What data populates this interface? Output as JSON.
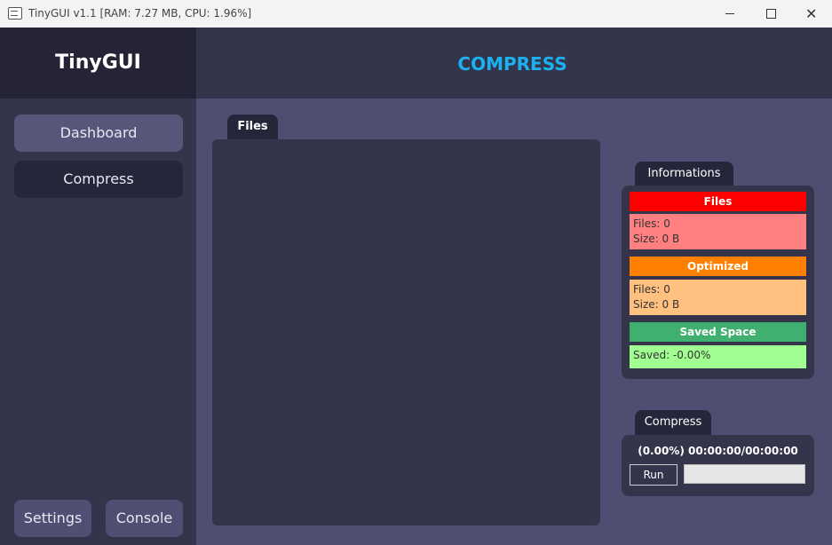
{
  "window": {
    "title": "TinyGUI v1.1 [RAM: 7.27 MB, CPU: 1.96%]",
    "close_glyph": "✕"
  },
  "sidebar": {
    "logo": "TinyGUI",
    "nav": [
      {
        "label": "Dashboard"
      },
      {
        "label": "Compress"
      }
    ],
    "bottom": [
      {
        "label": "Settings"
      },
      {
        "label": "Console"
      }
    ]
  },
  "header": {
    "title": "COMPRESS",
    "title_color": "#1ab2f0"
  },
  "files_panel": {
    "tab_label": "Files"
  },
  "informations": {
    "tab_label": "Informations",
    "files": {
      "header": "Files",
      "count": "Files: 0",
      "size": "Size: 0 B",
      "color": "#ff0000"
    },
    "optimized": {
      "header": "Optimized",
      "count": "Files: 0",
      "size": "Size: 0 B",
      "color": "#ff8000"
    },
    "saved": {
      "header": "Saved Space",
      "value": "Saved: -0.00%",
      "color": "#40b070"
    }
  },
  "compress": {
    "tab_label": "Compress",
    "progress_text": "(0.00%) 00:00:00/00:00:00",
    "progress_fraction": 0,
    "run_label": "Run"
  }
}
